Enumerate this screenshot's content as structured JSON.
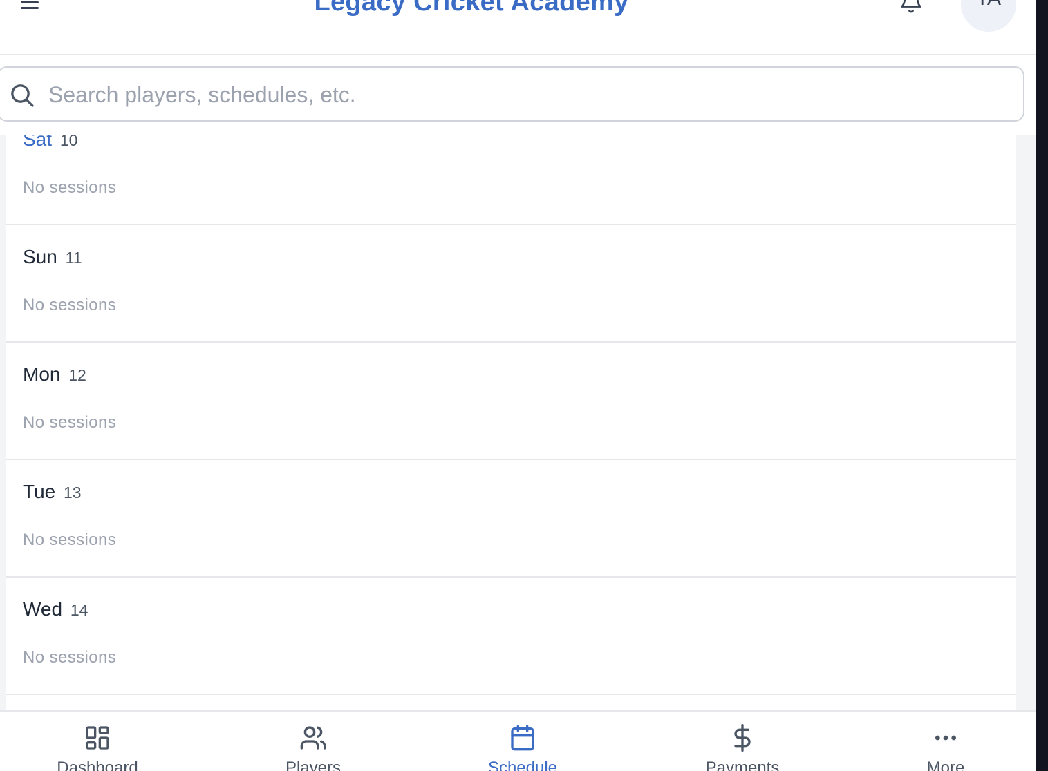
{
  "header": {
    "title": "Legacy Cricket Academy",
    "avatar_initials": "TA",
    "menu_icon": "hamburger-icon",
    "notification_icon": "bell-icon"
  },
  "search": {
    "placeholder": "Search players, schedules, etc.",
    "value": ""
  },
  "schedule": {
    "days": [
      {
        "weekday": "Sat",
        "date": "10",
        "status": "No sessions",
        "highlighted": true
      },
      {
        "weekday": "Sun",
        "date": "11",
        "status": "No sessions",
        "highlighted": false
      },
      {
        "weekday": "Mon",
        "date": "12",
        "status": "No sessions",
        "highlighted": false
      },
      {
        "weekday": "Tue",
        "date": "13",
        "status": "No sessions",
        "highlighted": false
      },
      {
        "weekday": "Wed",
        "date": "14",
        "status": "No sessions",
        "highlighted": false
      }
    ]
  },
  "nav": {
    "active": "Schedule",
    "items": [
      {
        "label": "Dashboard",
        "icon": "dashboard-icon"
      },
      {
        "label": "Players",
        "icon": "users-icon"
      },
      {
        "label": "Schedule",
        "icon": "calendar-icon"
      },
      {
        "label": "Payments",
        "icon": "dollar-icon"
      },
      {
        "label": "More",
        "icon": "more-icon"
      }
    ]
  },
  "colors": {
    "accent": "#3a6bc5",
    "text_muted": "#9ca3af",
    "border": "#e5e7eb"
  }
}
